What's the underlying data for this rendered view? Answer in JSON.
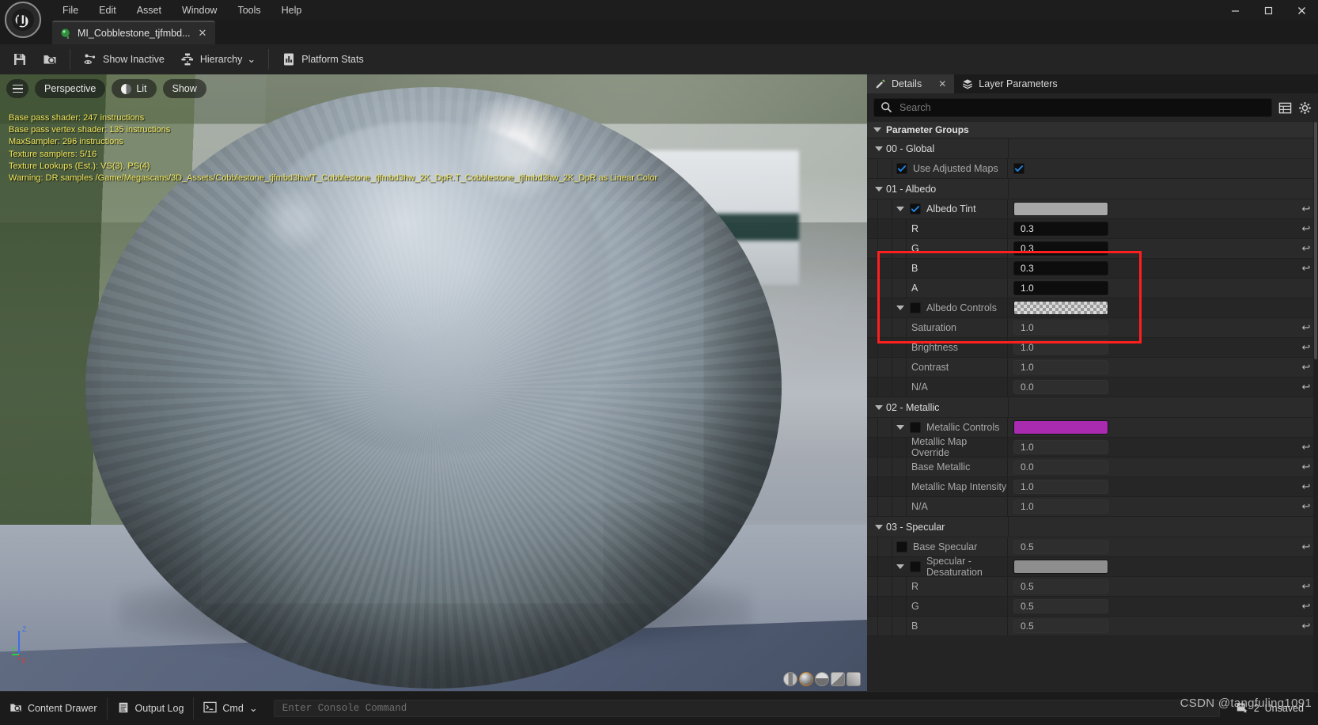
{
  "app": {
    "title": "Unreal Engine Material Instance Editor",
    "logo_icon": "unreal-engine-logo"
  },
  "menubar": {
    "items": [
      {
        "label": "File"
      },
      {
        "label": "Edit"
      },
      {
        "label": "Asset"
      },
      {
        "label": "Window"
      },
      {
        "label": "Tools"
      },
      {
        "label": "Help"
      }
    ]
  },
  "window_controls": {
    "minimize": "–",
    "maximize": "☐",
    "close": "✕"
  },
  "document_tab": {
    "label": "MI_Cobblestone_tjfmbd...",
    "close": "✕",
    "icon": "material-instance-icon"
  },
  "toolbar": {
    "save_label": "Save",
    "browse_label": "Browse",
    "show_inactive_label": "Show Inactive",
    "hierarchy_label": "Hierarchy",
    "platform_stats_label": "Platform Stats",
    "hierarchy_caret": "⌄"
  },
  "viewport": {
    "menu_icon": "hamburger-icon",
    "camera_mode": "Perspective",
    "view_mode": "Lit",
    "show_label": "Show",
    "stats_lines": [
      "Base pass shader: 247 instructions",
      "Base pass vertex shader: 135 instructions",
      "MaxSampler: 296 instructions",
      "Texture samplers: 5/16",
      "Texture Lookups (Est.): VS(3), PS(4)",
      "Warning: DR samples /Game/Megascans/3D_Assets/Cobblestone_tjfmbd3hw/T_Cobblestone_tjfmbd3hw_2K_DpR.T_Cobblestone_tjfmbd3hw_2K_DpR as Linear Color"
    ],
    "axis_labels": {
      "x": "X",
      "y": "Y",
      "z": "Z"
    },
    "preview_shapes": [
      "cylinder-preview",
      "sphere-preview",
      "plane-preview",
      "cube-preview",
      "custom-mesh-preview"
    ]
  },
  "panel": {
    "tabs": [
      {
        "label": "Details",
        "icon": "details-icon",
        "active": true,
        "closable": true
      },
      {
        "label": "Layer Parameters",
        "icon": "layers-icon",
        "active": false,
        "closable": false
      }
    ],
    "close_glyph": "✕",
    "search": {
      "placeholder": "Search",
      "value": "",
      "icon": "search-icon"
    },
    "toolbar_icons": [
      {
        "name": "table-view-icon"
      },
      {
        "name": "settings-gear-icon"
      }
    ],
    "root_group": "Parameter Groups",
    "reset_glyph": "↩",
    "groups": [
      {
        "name": "00 - Global",
        "rows": [
          {
            "label": "Use Adjusted Maps",
            "type": "checkbox",
            "checked": true,
            "enabled": false,
            "has_checkbox": true,
            "indent": 1,
            "reset": false
          }
        ]
      },
      {
        "name": "01 - Albedo",
        "rows": [
          {
            "label": "Albedo Tint",
            "type": "color",
            "color": "#a8a8a8",
            "checked": true,
            "enabled": true,
            "has_checkbox": true,
            "expander": true,
            "indent": 1,
            "reset": true
          },
          {
            "label": "R",
            "type": "number",
            "value": "0.3",
            "enabled": true,
            "indent": 2,
            "reset": true
          },
          {
            "label": "G",
            "type": "number",
            "value": "0.3",
            "enabled": true,
            "indent": 2,
            "reset": true
          },
          {
            "label": "B",
            "type": "number",
            "value": "0.3",
            "enabled": true,
            "indent": 2,
            "reset": true
          },
          {
            "label": "A",
            "type": "number",
            "value": "1.0",
            "enabled": true,
            "indent": 2,
            "reset": false
          },
          {
            "label": "Albedo Controls",
            "type": "color",
            "color": "checker",
            "checked": false,
            "enabled": false,
            "has_checkbox": true,
            "expander": true,
            "indent": 1,
            "reset": false
          },
          {
            "label": "Saturation",
            "type": "number",
            "value": "1.0",
            "enabled": false,
            "indent": 2,
            "reset": true
          },
          {
            "label": "Brightness",
            "type": "number",
            "value": "1.0",
            "enabled": false,
            "indent": 2,
            "reset": true
          },
          {
            "label": "Contrast",
            "type": "number",
            "value": "1.0",
            "enabled": false,
            "indent": 2,
            "reset": true
          },
          {
            "label": "N/A",
            "type": "number",
            "value": "0.0",
            "enabled": false,
            "indent": 2,
            "reset": true
          }
        ]
      },
      {
        "name": "02 - Metallic",
        "rows": [
          {
            "label": "Metallic Controls",
            "type": "color",
            "color": "#a92bb0",
            "checked": false,
            "enabled": false,
            "has_checkbox": true,
            "expander": true,
            "indent": 1,
            "reset": false
          },
          {
            "label": "Metallic Map Override",
            "type": "number",
            "value": "1.0",
            "enabled": false,
            "indent": 2,
            "reset": true
          },
          {
            "label": "Base Metallic",
            "type": "number",
            "value": "0.0",
            "enabled": false,
            "indent": 2,
            "reset": true
          },
          {
            "label": "Metallic Map Intensity",
            "type": "number",
            "value": "1.0",
            "enabled": false,
            "indent": 2,
            "reset": true
          },
          {
            "label": "N/A",
            "type": "number",
            "value": "1.0",
            "enabled": false,
            "indent": 2,
            "reset": true
          }
        ]
      },
      {
        "name": "03 - Specular",
        "rows": [
          {
            "label": "Base Specular",
            "type": "number",
            "value": "0.5",
            "checked": false,
            "enabled": false,
            "has_checkbox": true,
            "indent": 1,
            "reset": true
          },
          {
            "label": "Specular - Desaturation",
            "type": "color",
            "color": "#8e8e8e",
            "checked": false,
            "enabled": false,
            "has_checkbox": true,
            "expander": true,
            "indent": 1,
            "reset": false
          },
          {
            "label": "R",
            "type": "number",
            "value": "0.5",
            "enabled": false,
            "indent": 2,
            "reset": true
          },
          {
            "label": "G",
            "type": "number",
            "value": "0.5",
            "enabled": false,
            "indent": 2,
            "reset": true
          },
          {
            "label": "B",
            "type": "number",
            "value": "0.5",
            "enabled": false,
            "indent": 2,
            "reset": true
          }
        ]
      }
    ]
  },
  "statusbar": {
    "content_drawer": "Content Drawer",
    "output_log": "Output Log",
    "cmd_label": "Cmd",
    "cmd_caret": "⌄",
    "console_placeholder": "Enter Console Command",
    "source_control_count": "2",
    "source_control_label": "Unsaved",
    "watermark": "CSDN @tangfuling1091"
  },
  "colors": {
    "accent_blue": "#1f7fd0",
    "warning_yellow": "#f2e85c",
    "highlight_red": "#ff1f1f",
    "panel_bg": "#242424",
    "row_bg": "#2a2a2a"
  }
}
